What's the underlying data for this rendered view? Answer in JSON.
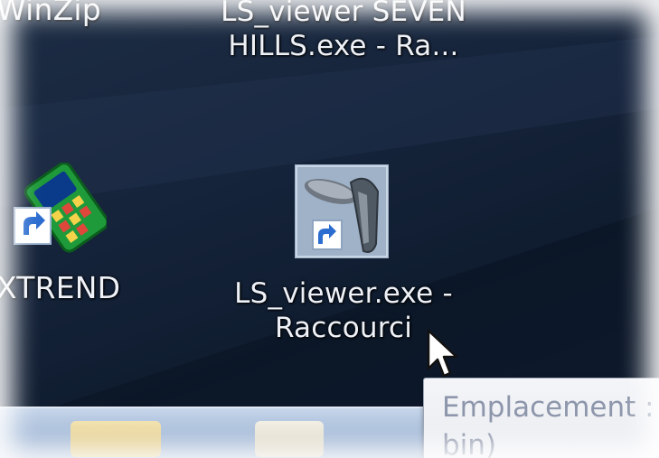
{
  "desktop": {
    "top_left_label": "WinZip",
    "top_center_label_line1": "LS_viewer SEVEN",
    "top_center_label_line2": "HILLS.exe - Ra...",
    "icons": [
      {
        "label": "XTREND",
        "icon": "xtrend-shortcut-icon"
      },
      {
        "label_line1": "LS_viewer.exe -",
        "label_line2": "Raccourci",
        "icon": "ls-viewer-shortcut-icon"
      }
    ]
  },
  "tooltip": {
    "line1": "Emplacement :",
    "line2": "bin)"
  },
  "taskbar": {
    "buttons": [
      {
        "icon": "folder-icon"
      },
      {
        "icon": "media-player-icon"
      }
    ]
  },
  "colors": {
    "desktop_background": "#15233a",
    "label_text": "#eef2f8",
    "tooltip_text": "#8d96ab",
    "taskbar": "#a4bad8"
  }
}
